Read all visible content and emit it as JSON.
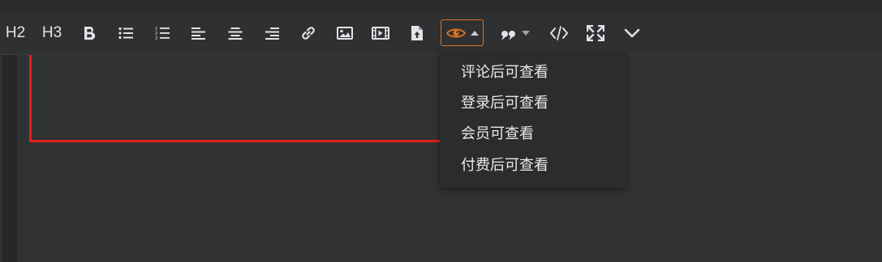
{
  "toolbar": {
    "h2_label": "H2",
    "h3_label": "H3",
    "icons": {
      "bold": "bold-icon",
      "bullet_list": "bullet-list-icon",
      "ordered_list": "ordered-list-icon",
      "align_left": "align-left-icon",
      "align_center": "align-center-icon",
      "align_right": "align-right-icon",
      "link": "link-icon",
      "image": "image-icon",
      "video": "video-icon",
      "upload": "upload-file-icon",
      "hide_content": "eye-icon",
      "quote": "quote-icon",
      "code": "code-icon",
      "fullscreen": "fullscreen-icon",
      "more": "chevron-down-icon"
    }
  },
  "dropdown": {
    "items": [
      {
        "label": "评论后可查看"
      },
      {
        "label": "登录后可查看"
      },
      {
        "label": "会员可查看"
      },
      {
        "label": "付费后可查看"
      }
    ]
  },
  "colors": {
    "accent": "#e0731f",
    "annotation": "#e0211b",
    "background": "#303133",
    "toolbar_text": "#e1e3e6"
  }
}
